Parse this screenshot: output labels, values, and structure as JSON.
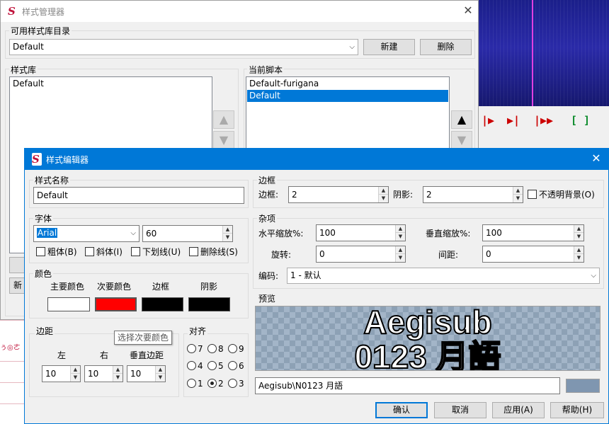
{
  "background": {
    "toolbar_icons": [
      "|▶",
      "▶|",
      "|▶▶",
      "[ ]"
    ]
  },
  "manager": {
    "title": "样式管理器",
    "catalog_label": "可用样式库目录",
    "catalog_value": "Default",
    "new_button": "新建",
    "delete_button": "删除",
    "storage_label": "样式库",
    "storage_items": [
      "Default"
    ],
    "script_label": "当前脚本",
    "script_items": [
      "Default-furigana",
      "Default"
    ],
    "script_selected": 1,
    "partial_button": "新"
  },
  "editor": {
    "title": "样式编辑器",
    "style_name_label": "样式名称",
    "style_name": "Default",
    "border_group": "边框",
    "outline_label": "边框:",
    "outline_value": "2",
    "shadow_label": "阴影:",
    "shadow_value": "2",
    "opaque_label": "不透明背景(O)",
    "font_group": "字体",
    "font_name": "Arial",
    "font_size": "60",
    "bold": "粗体(B)",
    "italic": "斜体(I)",
    "underline": "下划线(U)",
    "strikeout": "删除线(S)",
    "misc_group": "杂项",
    "scale_x_label": "水平缩放%:",
    "scale_x": "100",
    "scale_y_label": "垂直缩放%:",
    "scale_y": "100",
    "rotation_label": "旋转:",
    "rotation": "0",
    "spacing_label": "间距:",
    "spacing": "0",
    "encoding_label": "编码:",
    "encoding": "1 - 默认",
    "colors_group": "颜色",
    "primary_label": "主要颜色",
    "secondary_label": "次要颜色",
    "outline_color_label": "边框",
    "shadow_color_label": "阴影",
    "colors": {
      "primary": "#ffffff",
      "secondary": "#ff0000",
      "outline": "#000000",
      "shadow": "#000000"
    },
    "tooltip": "选择次要颜色",
    "margins_group": "边距",
    "left_label": "左",
    "right_label": "右",
    "vertical_label": "垂直边距",
    "margin_left": "10",
    "margin_right": "10",
    "margin_vertical": "10",
    "align_group": "对齐",
    "align_options": [
      "7",
      "8",
      "9",
      "4",
      "5",
      "6",
      "1",
      "2",
      "3"
    ],
    "align_selected": "2",
    "preview_group": "预览",
    "preview_line1": "Aegisub",
    "preview_line2": "0123 月語",
    "preview_text": "Aegisub\\N0123 月語",
    "preview_bg_color": "#7f96b0",
    "ok_button": "确认",
    "cancel_button": "取消",
    "apply_button": "应用(A)",
    "help_button": "帮助(H)"
  }
}
